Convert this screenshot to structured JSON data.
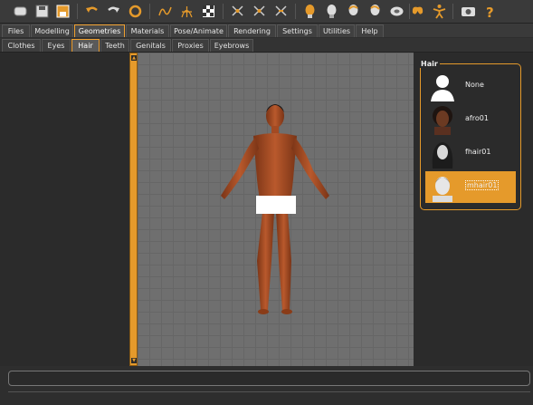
{
  "menu_tabs": [
    "Files",
    "Modelling",
    "Geometries",
    "Materials",
    "Pose/Animate",
    "Rendering",
    "Settings",
    "Utilities",
    "Help"
  ],
  "active_menu_tab": "Geometries",
  "sub_tabs": [
    "Clothes",
    "Eyes",
    "Hair",
    "Teeth",
    "Genitals",
    "Proxies",
    "Eyebrows"
  ],
  "active_sub_tab": "Hair",
  "hair_panel": {
    "title": "Hair",
    "items": [
      {
        "label": "None",
        "selected": false
      },
      {
        "label": "afro01",
        "selected": false
      },
      {
        "label": "fhair01",
        "selected": false
      },
      {
        "label": "mhair01",
        "selected": true
      }
    ]
  },
  "toolbar_icons": [
    "new-file-icon",
    "save-icon",
    "export-icon",
    "undo-icon",
    "redo-icon",
    "reset-icon",
    "smooth-icon",
    "wireframe-icon",
    "checker-icon",
    "front-view-icon",
    "back-view-icon",
    "side-view-icon",
    "head-front-icon",
    "head-back-icon",
    "head-left-icon",
    "head-right-icon",
    "top-view-icon",
    "pose-icon",
    "figure-icon",
    "screenshot-icon",
    "help-icon"
  ],
  "colors": {
    "accent": "#e59a2b",
    "background": "#2e2e2e",
    "viewport": "#6f6f6f"
  }
}
